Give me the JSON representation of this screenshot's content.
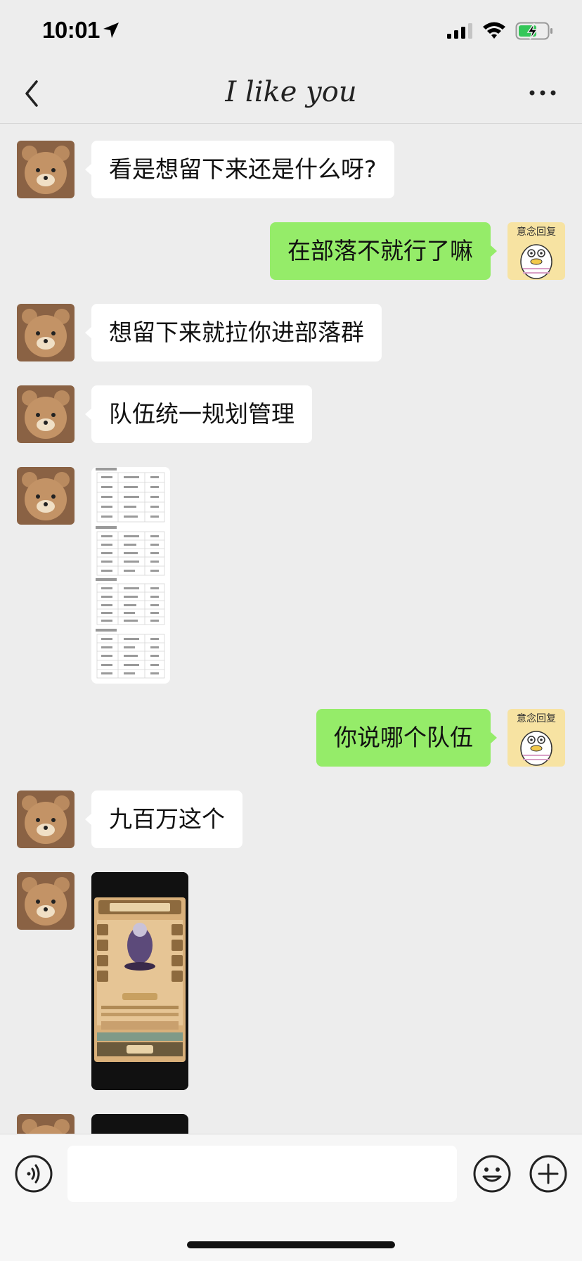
{
  "status_bar": {
    "time": "10:01"
  },
  "header": {
    "title": "I like you"
  },
  "messages": [
    {
      "side": "left",
      "type": "text",
      "text": "看是想留下来还是什么呀?"
    },
    {
      "side": "right",
      "type": "text",
      "text": "在部落不就行了嘛",
      "avatar_text": "意念回复"
    },
    {
      "side": "left",
      "type": "text",
      "text": "想留下来就拉你进部落群"
    },
    {
      "side": "left",
      "type": "text",
      "text": "队伍统一规划管理"
    },
    {
      "side": "left",
      "type": "image",
      "kind": "team-roster-screenshot"
    },
    {
      "side": "right",
      "type": "text",
      "text": "你说哪个队伍",
      "avatar_text": "意念回复"
    },
    {
      "side": "left",
      "type": "text",
      "text": "九百万这个"
    },
    {
      "side": "left",
      "type": "image",
      "kind": "game-screenshot"
    },
    {
      "side": "left",
      "type": "image",
      "kind": "dark-image-partial"
    }
  ],
  "input": {
    "placeholder": ""
  },
  "icons": {
    "back": "chevron-left-icon",
    "more": "more-dots-icon",
    "voice": "voice-icon",
    "emoji": "emoji-icon",
    "plus": "plus-icon"
  },
  "colors": {
    "background": "#ededed",
    "incoming_bubble": "#ffffff",
    "outgoing_bubble": "#95ec69",
    "battery_charging": "#34c759"
  }
}
